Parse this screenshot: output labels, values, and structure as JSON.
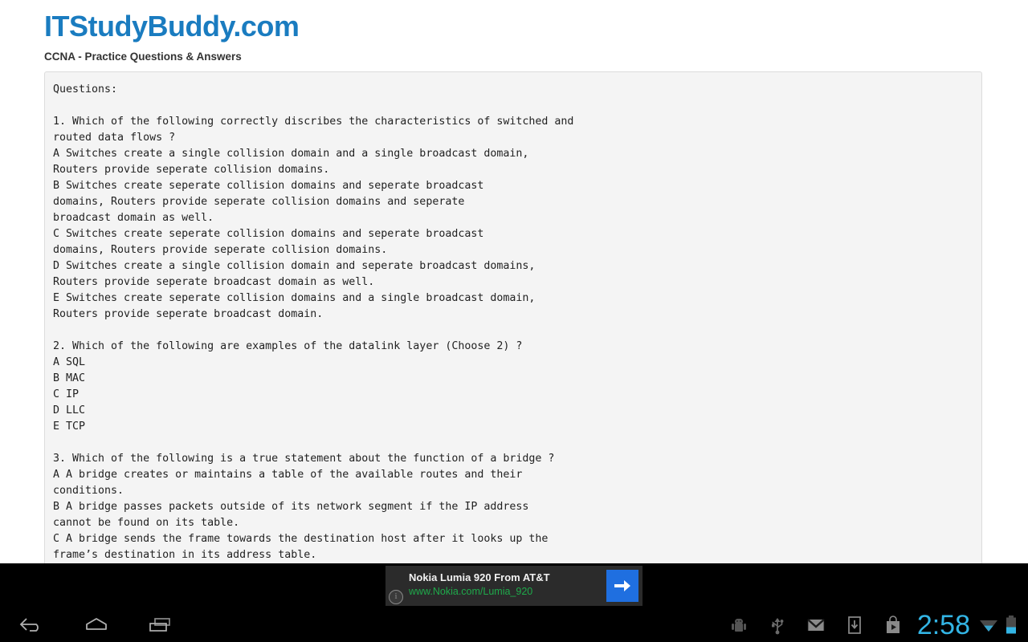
{
  "browser": {
    "site": {
      "logo": "ITStudyBuddy.com",
      "tagline": "CCNA - Practice Questions & Answers",
      "logo_color": "#1a7cc0"
    },
    "content": {
      "body_text": "Questions:\n\n1. Which of the following correctly discribes the characteristics of switched and\nrouted data flows ?\nA Switches create a single collision domain and a single broadcast domain,\nRouters provide seperate collision domains.\nB Switches create seperate collision domains and seperate broadcast\ndomains, Routers provide seperate collision domains and seperate\nbroadcast domain as well.\nC Switches create seperate collision domains and seperate broadcast\ndomains, Routers provide seperate collision domains.\nD Switches create a single collision domain and seperate broadcast domains,\nRouters provide seperate broadcast domain as well.\nE Switches create seperate collision domains and a single broadcast domain,\nRouters provide seperate broadcast domain.\n\n2. Which of the following are examples of the datalink layer (Choose 2) ?\nA SQL\nB MAC\nC IP\nD LLC\nE TCP\n\n3. Which of the following is a true statement about the function of a bridge ?\nA A bridge creates or maintains a table of the available routes and their\nconditions.\nB A bridge passes packets outside of its network segment if the IP address\ncannot be found on its table.\nC A bridge sends the frame towards the destination host after it looks up the\nframe’s destination in its address table."
    }
  },
  "ad": {
    "title": "Nokia Lumia 920 From AT&T",
    "url": "www.Nokia.com/Lumia_920",
    "url_color": "#1faa4b",
    "info_glyph": "i",
    "arrow_button_color": "#1f6fe0"
  },
  "system": {
    "nav": {
      "back_label": "Back",
      "home_label": "Home",
      "recents_label": "Recent apps"
    },
    "tray": {
      "icons": [
        {
          "name": "android-debug-icon",
          "label": "Android debugging"
        },
        {
          "name": "usb-icon",
          "label": "USB connected"
        },
        {
          "name": "gmail-icon",
          "label": "Gmail"
        },
        {
          "name": "download-icon",
          "label": "Download complete"
        },
        {
          "name": "play-store-icon",
          "label": "Play Store"
        }
      ],
      "clock": "2:58",
      "clock_color": "#33b5e5",
      "wifi_label": "Wi-Fi",
      "battery_label": "Battery",
      "battery_level_percent": 40
    }
  }
}
